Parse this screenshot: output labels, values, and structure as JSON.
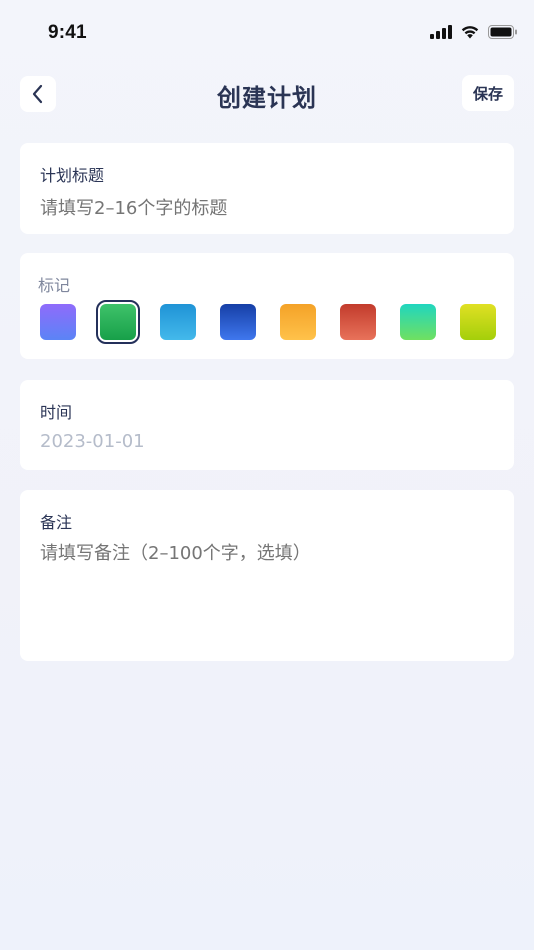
{
  "status_bar": {
    "time": "9:41",
    "icons": [
      "cellular-signal-icon",
      "wifi-icon",
      "battery-icon"
    ]
  },
  "nav": {
    "back_icon": "chevron-left-icon",
    "title": "创建计划",
    "save_label": "保存"
  },
  "form": {
    "title_field": {
      "label": "计划标题",
      "placeholder": "请填写2–16个字的标题"
    },
    "mark_field": {
      "label": "标记",
      "selected_index": 1,
      "swatches": [
        {
          "name": "purple",
          "colors": [
            "#8f6bfb",
            "#5b84f6"
          ]
        },
        {
          "name": "green",
          "colors": [
            "#3fc26a",
            "#17a049"
          ]
        },
        {
          "name": "sky-blue",
          "colors": [
            "#1f93d6",
            "#43b9eb"
          ]
        },
        {
          "name": "navy-blue",
          "colors": [
            "#163fa6",
            "#3f77ee"
          ]
        },
        {
          "name": "orange",
          "colors": [
            "#f4a228",
            "#ffc24a"
          ]
        },
        {
          "name": "red",
          "colors": [
            "#c23b2c",
            "#e8725a"
          ]
        },
        {
          "name": "teal",
          "colors": [
            "#20d6bf",
            "#70e060"
          ]
        },
        {
          "name": "lime",
          "colors": [
            "#e0e024",
            "#a4cf0a"
          ]
        }
      ]
    },
    "time_field": {
      "label": "时间",
      "value": "2023-01-01"
    },
    "note_field": {
      "label": "备注",
      "placeholder": "请填写备注（2–100个字，选填）"
    }
  }
}
